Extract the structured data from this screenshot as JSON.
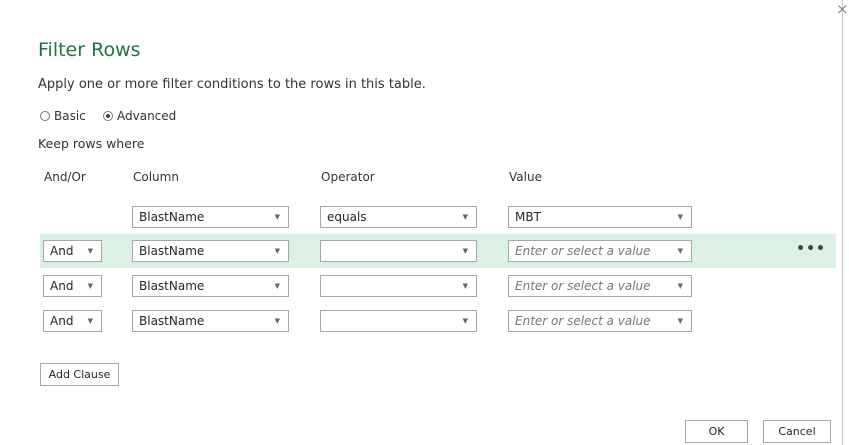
{
  "dialog": {
    "title": "Filter Rows",
    "subtitle": "Apply one or more filter conditions to the rows in this table.",
    "close_glyph": "×",
    "mode": {
      "basic_label": "Basic",
      "advanced_label": "Advanced",
      "selected": "Advanced"
    },
    "keep_label": "Keep rows where",
    "headers": {
      "andor": "And/Or",
      "column": "Column",
      "operator": "Operator",
      "value": "Value"
    },
    "rows": [
      {
        "andor": "",
        "column": "BlastName",
        "operator": "equals",
        "value": "MBT"
      },
      {
        "andor": "And",
        "column": "BlastName",
        "operator": "",
        "value": "Enter or select a value"
      },
      {
        "andor": "And",
        "column": "BlastName",
        "operator": "",
        "value": "Enter or select a value"
      },
      {
        "andor": "And",
        "column": "BlastName",
        "operator": "",
        "value": "Enter or select a value"
      }
    ],
    "more_glyph": "•••",
    "add_clause_label": "Add Clause",
    "ok_label": "OK",
    "cancel_label": "Cancel",
    "arrow_glyph": "▼",
    "colors": {
      "title": "#217346",
      "highlight_row": "#dcf1e6"
    }
  }
}
